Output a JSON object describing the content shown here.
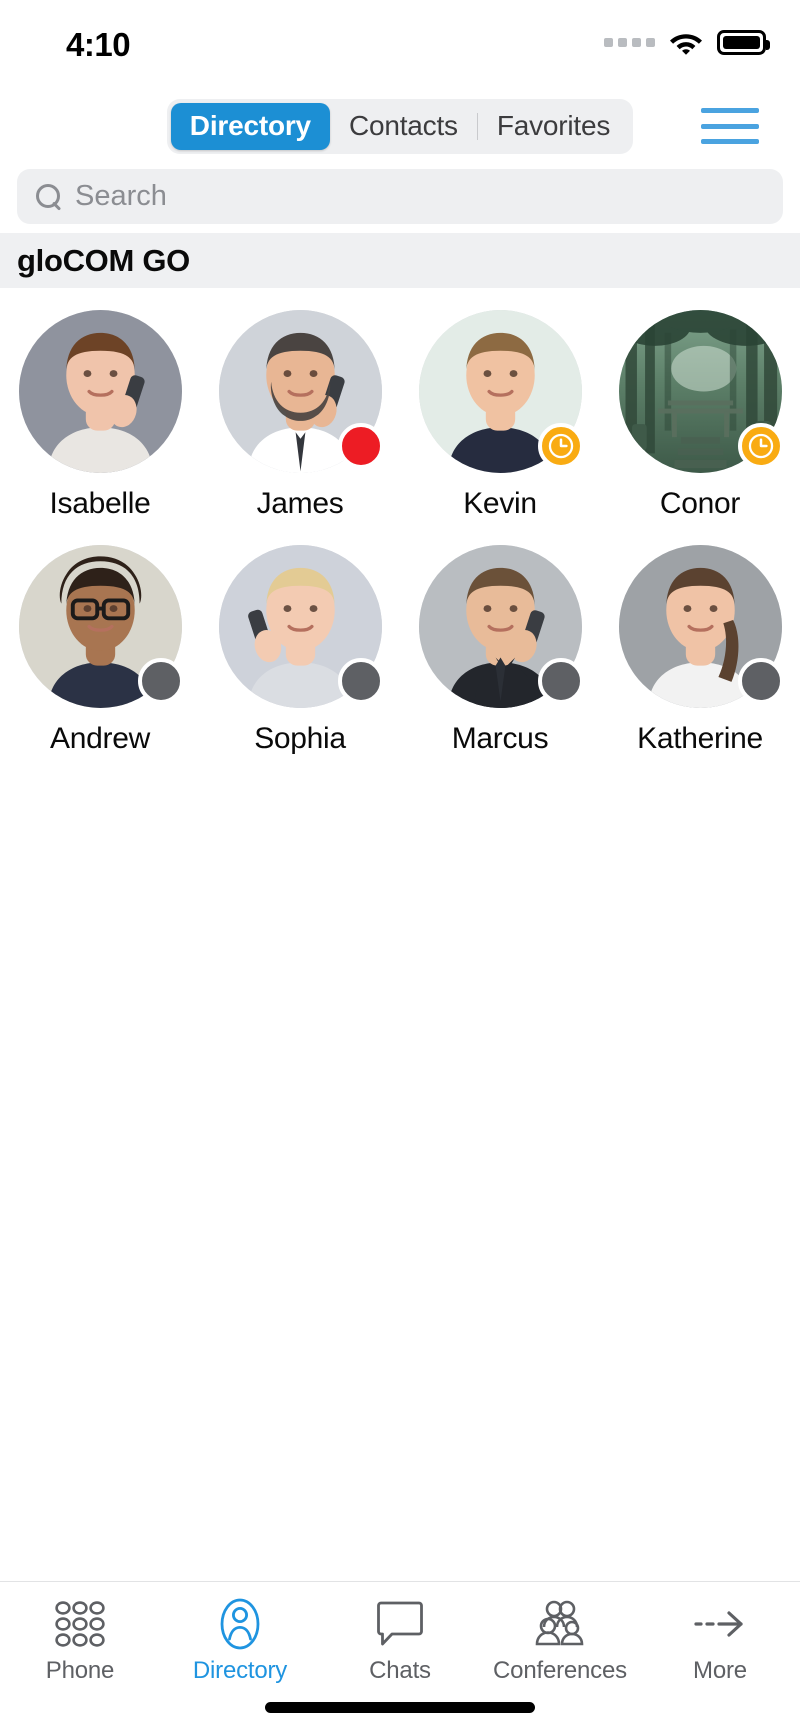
{
  "status_bar": {
    "time": "4:10",
    "signal_icon": "signal-dots-icon",
    "wifi_icon": "wifi-icon",
    "battery_icon": "battery-full-icon"
  },
  "nav": {
    "segments": [
      {
        "label": "Directory",
        "active": true
      },
      {
        "label": "Contacts",
        "active": false
      },
      {
        "label": "Favorites",
        "active": false
      }
    ],
    "menu_icon": "hamburger-menu-icon",
    "accent_color": "#1c8fd4"
  },
  "search": {
    "placeholder": "Search",
    "value": "",
    "icon": "search-icon"
  },
  "section": {
    "title": "gloCOM GO"
  },
  "contacts": [
    {
      "name": "Isabelle",
      "status": "none",
      "badge_icon": ""
    },
    {
      "name": "James",
      "status": "dnd",
      "badge_icon": "dnd-dot-icon"
    },
    {
      "name": "Kevin",
      "status": "away",
      "badge_icon": "clock-icon"
    },
    {
      "name": "Conor",
      "status": "away",
      "badge_icon": "clock-icon"
    },
    {
      "name": "Andrew",
      "status": "offline",
      "badge_icon": "offline-dot-icon"
    },
    {
      "name": "Sophia",
      "status": "offline",
      "badge_icon": "offline-dot-icon"
    },
    {
      "name": "Marcus",
      "status": "offline",
      "badge_icon": "offline-dot-icon"
    },
    {
      "name": "Katherine",
      "status": "offline",
      "badge_icon": "offline-dot-icon"
    }
  ],
  "status_colors": {
    "dnd": "#ed1c24",
    "away": "#f9ab12",
    "offline": "#5e6064"
  },
  "tabbar": {
    "items": [
      {
        "label": "Phone",
        "icon": "dialpad-icon",
        "active": false
      },
      {
        "label": "Directory",
        "icon": "person-icon",
        "active": true
      },
      {
        "label": "Chats",
        "icon": "chat-bubble-icon",
        "active": false
      },
      {
        "label": "Conferences",
        "icon": "group-icon",
        "active": false
      },
      {
        "label": "More",
        "icon": "arrow-right-icon",
        "active": false
      }
    ],
    "active_color": "#1f94e0"
  }
}
